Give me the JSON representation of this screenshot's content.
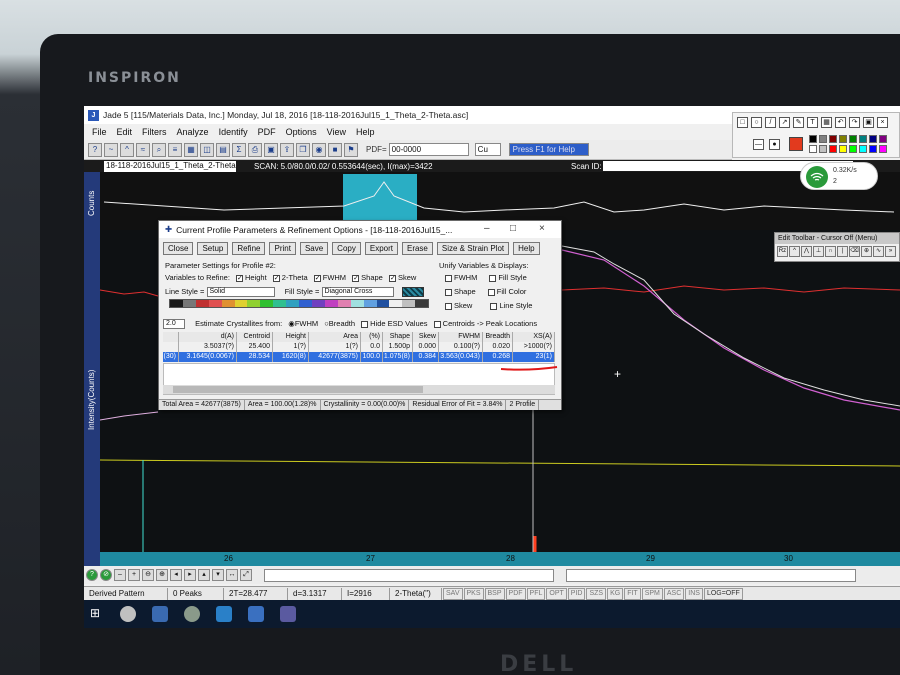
{
  "window": {
    "title": "Jade 5 [115/Materials Data, Inc.] Monday, Jul 18, 2016 [18-118-2016Jul15_1_Theta_2-Theta.asc]",
    "brand": "INSPIRON"
  },
  "menu": [
    "File",
    "Edit",
    "Filters",
    "Analyze",
    "Identify",
    "PDF",
    "Options",
    "View",
    "Help"
  ],
  "toolbar": {
    "pdf_label": "PDF=",
    "pdf_value": "00-0000",
    "element_value": "Cu",
    "help_hint": "Press F1 for Help"
  },
  "scan_strip": {
    "file": "18-118-2016Jul15_1_Theta_2-Theta",
    "scan_info": "SCAN: 5.0/80.0/0.02/ 0.553644(sec), I(max)=3422",
    "scan_id_label": "Scan ID:"
  },
  "plot": {
    "top_axis_label": "Counts",
    "main_axis_label": "Intensity(Counts)",
    "x_ticks": [
      "26",
      "27",
      "28",
      "29",
      "30"
    ]
  },
  "wifi": {
    "line1": "0.32K/s",
    "line2": "2"
  },
  "dialog": {
    "title": "Current Profile Parameters & Refinement Options - [18-118-2016Jul15_...",
    "buttons": [
      "Close",
      "Setup",
      "Refine",
      "Print",
      "Save",
      "Copy",
      "Export",
      "Erase",
      "Size & Strain Plot",
      "Help"
    ],
    "param_group": "Parameter Settings for Profile #2:",
    "vars_label": "Variables to Refine:",
    "vars": [
      "Height",
      "2-Theta",
      "FWHM",
      "Shape",
      "Skew"
    ],
    "line_style_label": "Line Style =",
    "line_style_value": "Solid",
    "fill_style_label": "Fill Style =",
    "fill_style_value": "Diagonal Cross",
    "unify_group": "Unify Variables & Displays:",
    "unify": [
      "FWHM",
      "Fill Style",
      "Shape",
      "Fill Color",
      "Skew",
      "Line Style"
    ],
    "crystallite_value": "2.0",
    "estimate_label": "Estimate Crystallites from:",
    "estimate_opts": [
      "FWHM",
      "Breadth"
    ],
    "hide_esd": "Hide ESD Values",
    "centroids": "Centroids -> Peak Locations",
    "headers": [
      "",
      "d(A)",
      "Centroid",
      "Height",
      "Area",
      "(%)",
      "Shape",
      "Skew",
      "FWHM",
      "Breadth",
      "XS(A)"
    ],
    "rows": [
      [
        "",
        "3.5037(?)",
        "25.400",
        "1(?)",
        "1(?)",
        "0.0",
        "1.500p",
        "0.000",
        "0.100(?)",
        "0.020",
        ">1000(?)"
      ],
      [
        "(30)",
        "3.1645(0.0067)",
        "28.534",
        "1620(8)",
        "42677(3875)",
        "100.0",
        "1.075(8)",
        "0.384",
        "3.563(0.043)",
        "0.268",
        "23(1)"
      ]
    ],
    "status": [
      "Total Area = 42677(3875)",
      "Area = 100.00(1.28)%",
      "Crystallinity = 0.00(0.00)%",
      "Residual Error of Fit = 3.84%",
      "2 Profile"
    ]
  },
  "edit_toolbar": {
    "title": "Edit Toolbar - Cursor Off (Menu)",
    "first_icon": "Rz"
  },
  "statusbar": {
    "cells": [
      "Derived Pattern",
      "0 Peaks",
      "2T=28.477",
      "d=3.1317",
      "I=2916",
      "2-Theta(\")"
    ],
    "mini": [
      "SAV",
      "PKS",
      "BSP",
      "PDF",
      "PFL",
      "OPT",
      "PID",
      "SZS",
      "KG",
      "FIT",
      "SPM",
      "ASC",
      "INS"
    ],
    "log": "LOG=OFF"
  },
  "bezel_logo": "DELL",
  "colors": {
    "highlight": "#2f6fe0",
    "xaxis": "#1f8aa0",
    "peak_band": "#2ec0d8"
  }
}
